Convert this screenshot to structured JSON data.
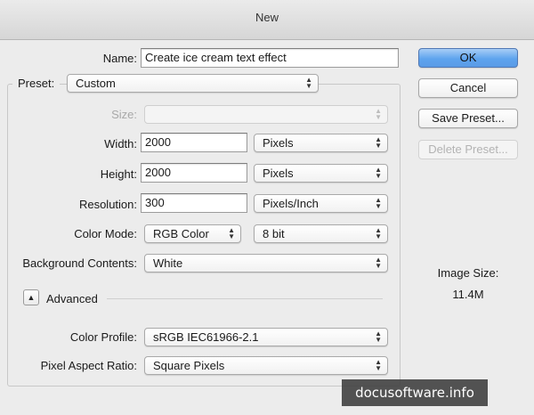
{
  "window": {
    "title": "New"
  },
  "name": {
    "label": "Name:",
    "value": "Create ice cream text effect"
  },
  "preset": {
    "label": "Preset:",
    "value": "Custom"
  },
  "size": {
    "label": "Size:",
    "value": ""
  },
  "width": {
    "label": "Width:",
    "value": "2000",
    "unit": "Pixels"
  },
  "height": {
    "label": "Height:",
    "value": "2000",
    "unit": "Pixels"
  },
  "resolution": {
    "label": "Resolution:",
    "value": "300",
    "unit": "Pixels/Inch"
  },
  "color_mode": {
    "label": "Color Mode:",
    "value": "RGB Color",
    "depth": "8 bit"
  },
  "background": {
    "label": "Background Contents:",
    "value": "White"
  },
  "advanced": {
    "label": "Advanced",
    "expanded": false
  },
  "color_profile": {
    "label": "Color Profile:",
    "value": "sRGB IEC61966-2.1"
  },
  "pixel_aspect": {
    "label": "Pixel Aspect Ratio:",
    "value": "Square Pixels"
  },
  "buttons": {
    "ok": "OK",
    "cancel": "Cancel",
    "save_preset": "Save Preset...",
    "delete_preset": "Delete Preset..."
  },
  "image_size": {
    "label": "Image Size:",
    "value": "11.4M"
  },
  "watermark": "docusoftware.info",
  "colors": {
    "accent": "#5ea4ee",
    "window_bg": "#ececec"
  }
}
